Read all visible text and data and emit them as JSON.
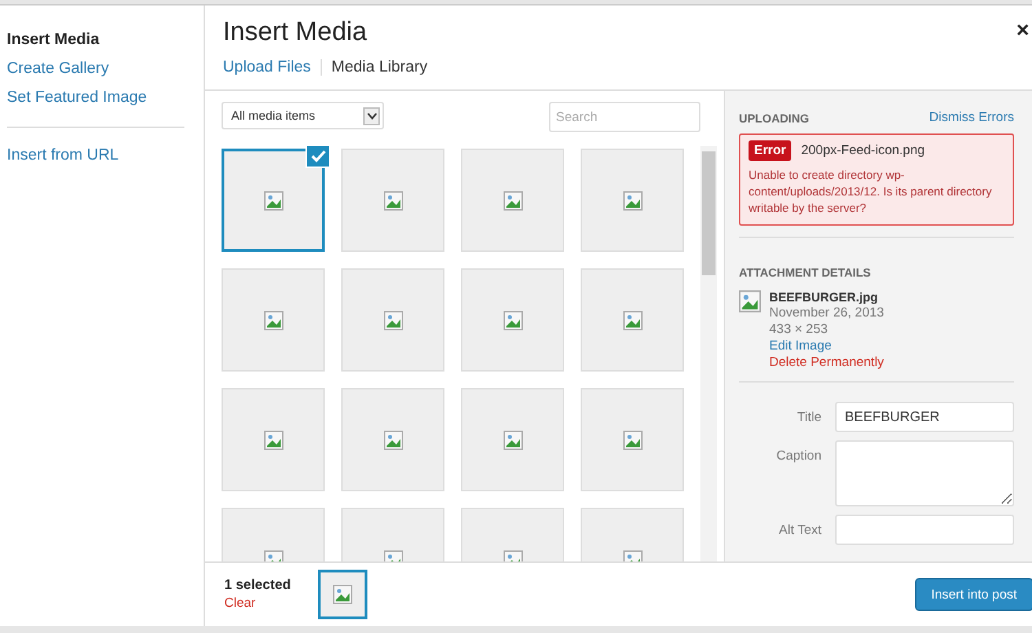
{
  "sidebar": {
    "menu": [
      {
        "label": "Insert Media",
        "selected": true
      },
      {
        "label": "Create Gallery",
        "selected": false
      },
      {
        "label": "Set Featured Image",
        "selected": false
      }
    ],
    "links": [
      {
        "label": "Insert from URL",
        "selected": false
      }
    ]
  },
  "modal": {
    "title": "Insert Media",
    "close": "×",
    "tabs": [
      {
        "label": "Upload Files",
        "selected": false
      },
      {
        "label": "Media Library",
        "selected": true
      }
    ],
    "filter": {
      "value": "All media items"
    },
    "search": {
      "placeholder": "Search"
    }
  },
  "media": [
    {
      "selected": true
    },
    {
      "selected": false
    },
    {
      "selected": false
    },
    {
      "selected": false
    },
    {
      "selected": false
    },
    {
      "selected": false
    },
    {
      "selected": false
    },
    {
      "selected": false
    },
    {
      "selected": false
    },
    {
      "selected": false
    },
    {
      "selected": false
    },
    {
      "selected": false
    },
    {
      "selected": false
    },
    {
      "selected": false
    },
    {
      "selected": false
    },
    {
      "selected": false
    }
  ],
  "uploading": {
    "heading": "UPLOADING",
    "dismiss": "Dismiss Errors",
    "error": {
      "badge": "Error",
      "filename": "200px-Feed-icon.png",
      "message": "Unable to create directory wp-content/uploads/2013/12. Is its parent directory writable by the server?"
    }
  },
  "attachment": {
    "heading": "ATTACHMENT DETAILS",
    "filename": "BEEFBURGER.jpg",
    "date": "November 26, 2013",
    "dimensions": "433 × 253",
    "edit": "Edit Image",
    "delete": "Delete Permanently",
    "fields": [
      {
        "label": "Title",
        "value": "BEEFBURGER",
        "kind": "input"
      },
      {
        "label": "Caption",
        "kind": "textarea"
      },
      {
        "label": "Alt Text",
        "kind": "input"
      }
    ]
  },
  "footer": {
    "count": "1 selected",
    "clear": "Clear",
    "button": "Insert into post"
  }
}
